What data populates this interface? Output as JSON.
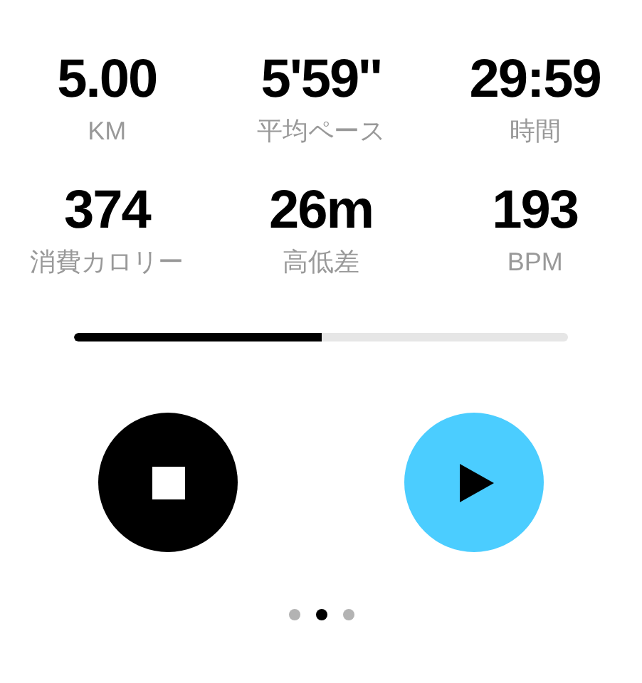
{
  "stats": [
    {
      "value": "5.00",
      "label": "KM"
    },
    {
      "value": "5'59''",
      "label": "平均ペース"
    },
    {
      "value": "29:59",
      "label": "時間"
    },
    {
      "value": "374",
      "label": "消費カロリー"
    },
    {
      "value": "26m",
      "label": "高低差"
    },
    {
      "value": "193",
      "label": "BPM"
    }
  ],
  "progress": {
    "level": 0.5
  },
  "controls": [
    {
      "kind": "stop"
    },
    {
      "kind": "play"
    }
  ],
  "page_dots": [
    {
      "selected": false
    },
    {
      "selected": true
    },
    {
      "selected": false
    }
  ]
}
